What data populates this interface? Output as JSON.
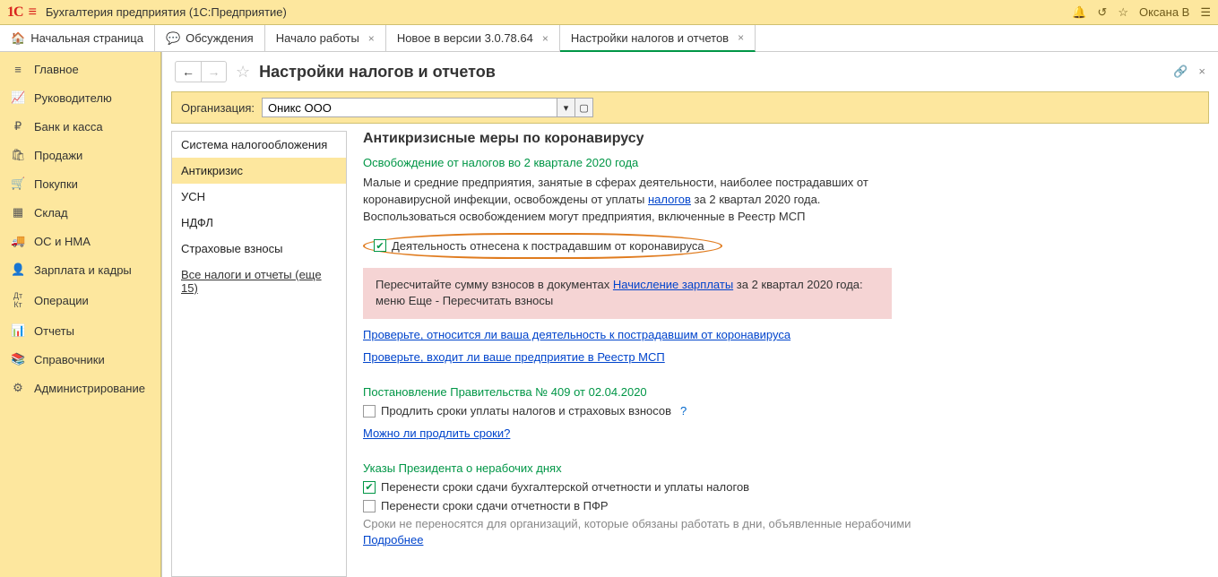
{
  "titlebar": {
    "app_title": "Бухгалтерия предприятия   (1С:Предприятие)",
    "user": "Оксана В"
  },
  "tabs": {
    "home": "Начальная страница",
    "discussions": "Обсуждения",
    "start": "Начало работы",
    "new_version": "Новое в версии 3.0.78.64",
    "settings": "Настройки налогов и отчетов"
  },
  "sidebar": {
    "items": [
      {
        "icon": "≡",
        "label": "Главное"
      },
      {
        "icon": "📈",
        "label": "Руководителю"
      },
      {
        "icon": "₽",
        "label": "Банк и касса"
      },
      {
        "icon": "🛍",
        "label": "Продажи"
      },
      {
        "icon": "🛒",
        "label": "Покупки"
      },
      {
        "icon": "▦",
        "label": "Склад"
      },
      {
        "icon": "🚚",
        "label": "ОС и НМА"
      },
      {
        "icon": "👤",
        "label": "Зарплата и кадры"
      },
      {
        "icon": "Дт Кт",
        "label": "Операции"
      },
      {
        "icon": "📊",
        "label": "Отчеты"
      },
      {
        "icon": "📚",
        "label": "Справочники"
      },
      {
        "icon": "⚙",
        "label": "Администрирование"
      }
    ]
  },
  "content": {
    "title": "Настройки налогов и отчетов",
    "org_label": "Организация:",
    "org_value": "Оникс ООО"
  },
  "navlist": {
    "items": [
      "Система налогообложения",
      "Антикризис",
      "УСН",
      "НДФЛ",
      "Страховые взносы",
      "Все налоги и отчеты (еще 15)"
    ]
  },
  "main": {
    "heading": "Антикризисные меры по коронавирусу",
    "section1": "Освобождение от налогов во 2 квартале 2020 года",
    "para1a": "Малые и средние предприятия, занятые в сферах деятельности, наиболее пострадавших от коронавирусной инфекции, освобождены от уплаты ",
    "para1_link": "налогов",
    "para1b": " за 2 квартал 2020 года. Воспользоваться освобождением могут предприятия, включенные в Реестр МСП",
    "chk1": "Деятельность отнесена к пострадавшим от коронавируса",
    "pink_a": "Пересчитайте сумму взносов в документах ",
    "pink_link": "Начисление зарплаты",
    "pink_b": " за 2 квартал 2020 года: меню Еще - Пересчитать взносы",
    "link1": "Проверьте, относится ли ваша деятельность к пострадавшим от коронавируса",
    "link2": "Проверьте, входит ли ваше предприятие в Реестр МСП",
    "section2": "Постановление Правительства № 409 от 02.04.2020",
    "chk2": "Продлить сроки уплаты налогов и страховых взносов",
    "link3": "Можно ли продлить сроки?",
    "section3": "Указы Президента о нерабочих днях",
    "chk3": "Перенести сроки сдачи бухгалтерской отчетности и уплаты налогов",
    "chk4": "Перенести сроки сдачи отчетности в ПФР",
    "muted": "Сроки не переносятся для организаций, которые обязаны работать в дни, объявленные нерабочими ",
    "muted_link": "Подробнее"
  }
}
